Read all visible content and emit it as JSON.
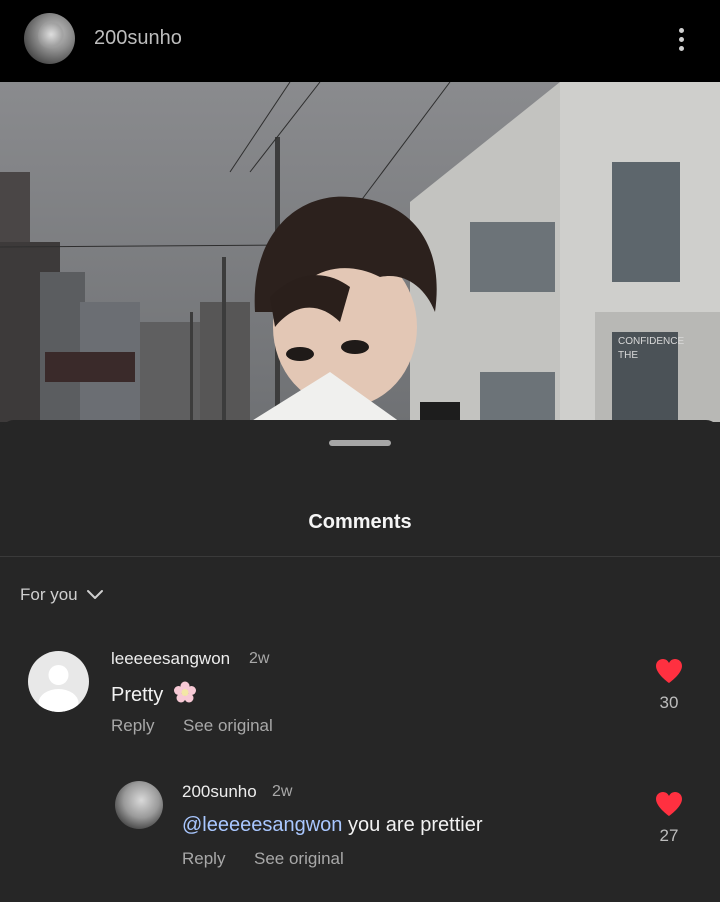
{
  "header": {
    "username": "200sunho"
  },
  "photo": {
    "sign_text_1": "CONFIDENCE",
    "sign_text_2": "THE"
  },
  "sheet": {
    "title": "Comments",
    "filter_label": "For you"
  },
  "comments": [
    {
      "username": "leeeeesangwon",
      "time": "2w",
      "text": "Pretty",
      "emoji": "flower",
      "reply_label": "Reply",
      "see_original_label": "See original",
      "likes": "30"
    },
    {
      "username": "200sunho",
      "time": "2w",
      "mention": "@leeeeesangwon",
      "text": " you are prettier",
      "reply_label": "Reply",
      "see_original_label": "See original",
      "likes": "27"
    }
  ],
  "colors": {
    "like": "#ff3040",
    "mention": "#a9c7ff",
    "sheet_bg": "#262626"
  }
}
